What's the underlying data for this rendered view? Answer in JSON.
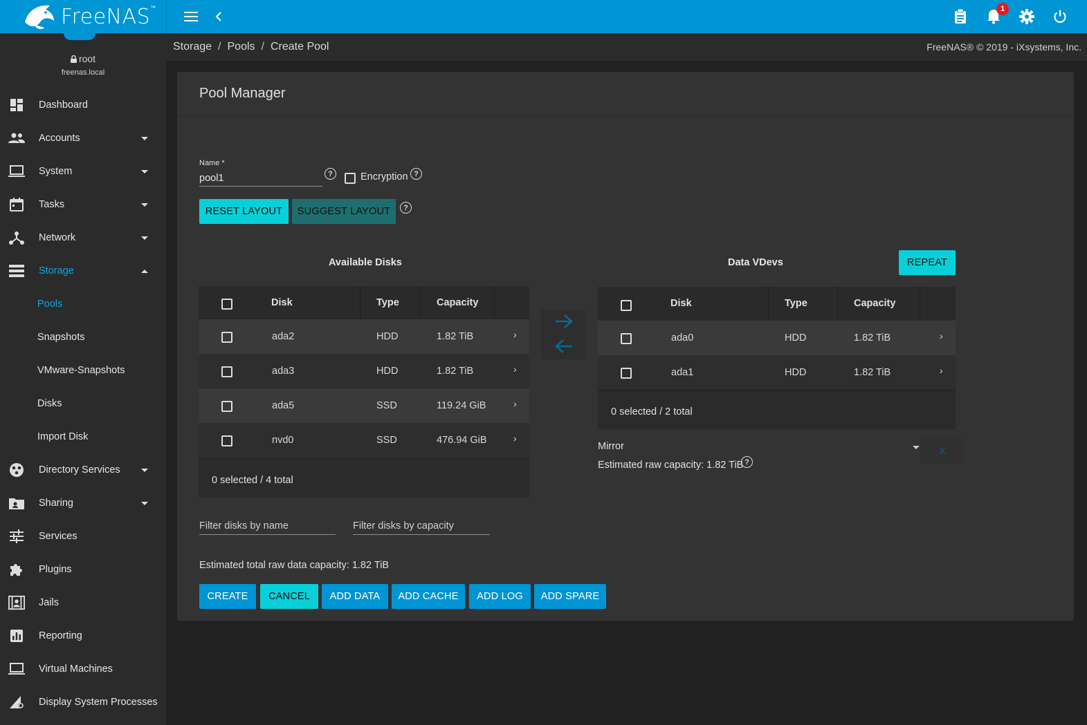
{
  "app": {
    "name": "FreeNAS",
    "trademark": "™"
  },
  "colors": {
    "topbar": "#0095d5",
    "accent_cyan": "#07d0d8",
    "accent_teal": "#1f6e6f",
    "active_nav": "#0ba5e9",
    "badge": "#e21d1d"
  },
  "topbar": {
    "notifications_count": "1"
  },
  "user": {
    "name": "root",
    "host": "freenas.local"
  },
  "sidebar": {
    "items": [
      {
        "label": "Dashboard",
        "icon": "dashboard-icon"
      },
      {
        "label": "Accounts",
        "icon": "people-icon"
      },
      {
        "label": "System",
        "icon": "laptop-icon"
      },
      {
        "label": "Tasks",
        "icon": "calendar-icon"
      },
      {
        "label": "Network",
        "icon": "network-icon"
      },
      {
        "label": "Storage",
        "icon": "storage-icon"
      },
      {
        "label": "Directory Services",
        "icon": "directory-icon"
      },
      {
        "label": "Sharing",
        "icon": "sharing-icon"
      },
      {
        "label": "Services",
        "icon": "tune-icon"
      },
      {
        "label": "Plugins",
        "icon": "puzzle-icon"
      },
      {
        "label": "Jails",
        "icon": "jail-icon"
      },
      {
        "label": "Reporting",
        "icon": "chart-icon"
      },
      {
        "label": "Virtual Machines",
        "icon": "laptop-icon"
      },
      {
        "label": "Display System Processes",
        "icon": "processes-icon"
      }
    ],
    "storage_sub": [
      "Pools",
      "Snapshots",
      "VMware-Snapshots",
      "Disks",
      "Import Disk"
    ]
  },
  "breadcrumb": {
    "items": [
      "Storage",
      "Pools",
      "Create Pool"
    ],
    "separator": "/"
  },
  "copyright": "FreeNAS® © 2019 - iXsystems, Inc.",
  "pool": {
    "title": "Pool Manager",
    "name_label": "Name *",
    "name_value": "pool1",
    "encryption_label": "Encryption",
    "help": "?",
    "reset_layout": "RESET LAYOUT",
    "suggest_layout": "SUGGEST LAYOUT"
  },
  "available": {
    "title": "Available Disks",
    "headers": [
      "Disk",
      "Type",
      "Capacity"
    ],
    "rows": [
      {
        "disk": "ada2",
        "type": "HDD",
        "capacity": "1.82 TiB"
      },
      {
        "disk": "ada3",
        "type": "HDD",
        "capacity": "1.82 TiB"
      },
      {
        "disk": "ada5",
        "type": "SSD",
        "capacity": "119.24 GiB"
      },
      {
        "disk": "nvd0",
        "type": "SSD",
        "capacity": "476.94 GiB"
      }
    ],
    "footer": "0 selected / 4 total",
    "filter_name_placeholder": "Filter disks by name",
    "filter_capacity_placeholder": "Filter disks by capacity"
  },
  "vdevs": {
    "title": "Data VDevs",
    "repeat": "REPEAT",
    "headers": [
      "Disk",
      "Type",
      "Capacity"
    ],
    "rows": [
      {
        "disk": "ada0",
        "type": "HDD",
        "capacity": "1.82 TiB"
      },
      {
        "disk": "ada1",
        "type": "HDD",
        "capacity": "1.82 TiB"
      }
    ],
    "footer": "0 selected / 2 total",
    "layout_value": "Mirror",
    "estimated": "Estimated raw capacity: 1.82 TiB",
    "remove": "X"
  },
  "total_estimate": "Estimated total raw data capacity: 1.82 TiB",
  "actions": {
    "create": "CREATE",
    "cancel": "CANCEL",
    "add_data": "ADD DATA",
    "add_cache": "ADD CACHE",
    "add_log": "ADD LOG",
    "add_spare": "ADD SPARE"
  }
}
